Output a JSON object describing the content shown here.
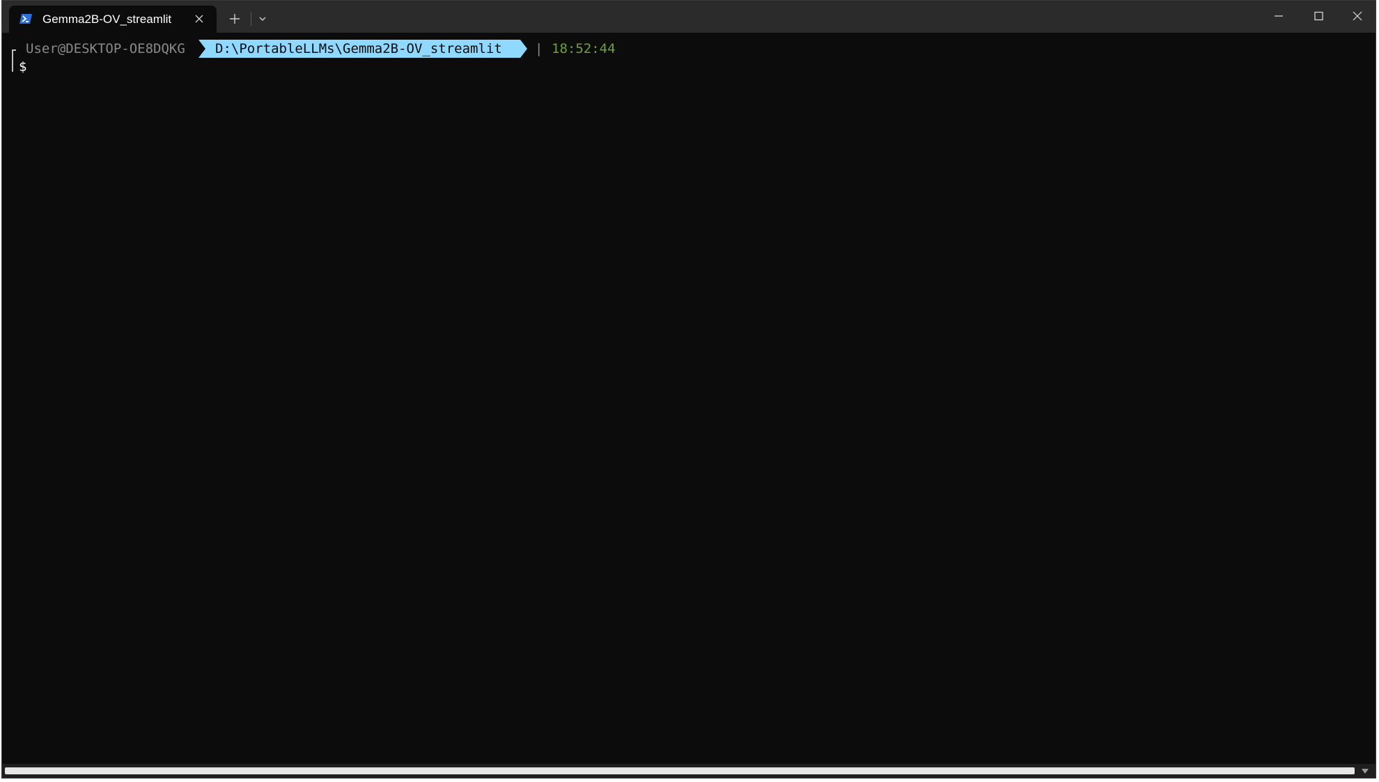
{
  "window": {
    "tab_title": "Gemma2B-OV_streamlit",
    "tab_icon": "powershell-icon"
  },
  "colors": {
    "background": "#0c0c0c",
    "titlebar": "#2b2b2b",
    "path_segment": "#8fd8ff",
    "time": "#6da23a",
    "user": "#8a8a8a"
  },
  "prompt": {
    "user_host": "User@DESKTOP-OE8DQKG",
    "path": "D:\\PortableLLMs\\Gemma2B-OV_streamlit",
    "separator": "|",
    "time": "18:52:44",
    "symbol": "$"
  }
}
